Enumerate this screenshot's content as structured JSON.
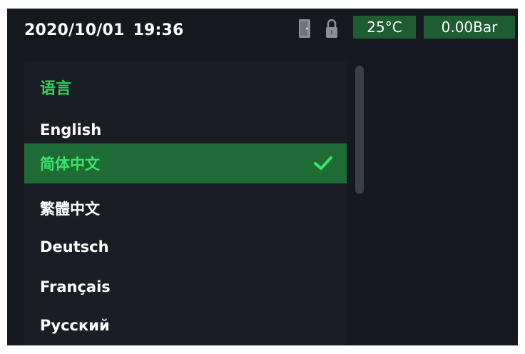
{
  "status": {
    "date": "2020/10/01",
    "time": "19:36",
    "temperature": "25°C",
    "pressure": "0.00Bar",
    "icons": [
      "door-icon",
      "lock-icon"
    ]
  },
  "language_menu": {
    "title": "语言",
    "items": [
      {
        "label": "English",
        "selected": false
      },
      {
        "label": "简体中文",
        "selected": true
      },
      {
        "label": "繁體中文",
        "selected": false
      },
      {
        "label": "Deutsch",
        "selected": false
      },
      {
        "label": "Français",
        "selected": false
      },
      {
        "label": "Русский",
        "selected": false
      }
    ],
    "selected_icon": "check-icon"
  },
  "colors": {
    "background": "#15191f",
    "accent": "#2ed15c",
    "pill": "#1e5c31",
    "selected_row": "#1f6b36"
  }
}
